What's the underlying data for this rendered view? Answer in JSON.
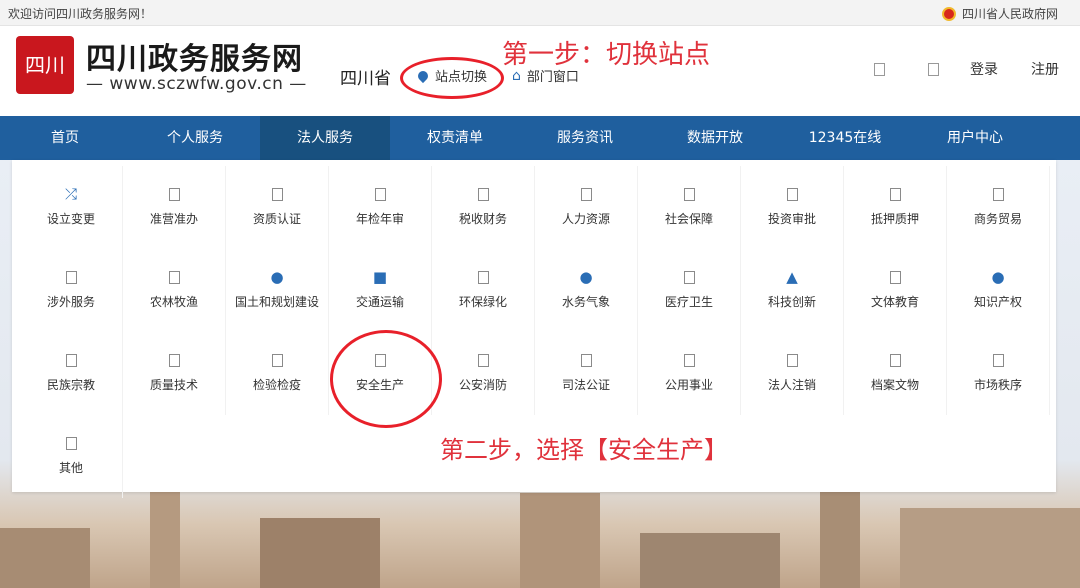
{
  "topbar": {
    "welcome": "欢迎访问四川政务服务网！",
    "gov_link": "四川省人民政府网"
  },
  "header": {
    "seal_text": "四川",
    "title": "四川政务服务网",
    "url": "— www.sczwfw.gov.cn —",
    "province": "四川省",
    "switch_label": "站点切换",
    "dept_label": "部门窗口",
    "login": "登录",
    "register": "注册"
  },
  "annotations": {
    "step1": "第一步：切换站点",
    "step2": "第二步，选择【安全生产】",
    "circle_color": "#e8202a"
  },
  "nav": [
    "首页",
    "个人服务",
    "法人服务",
    "权责清单",
    "服务资讯",
    "数据开放",
    "12345在线",
    "用户中心"
  ],
  "nav_active": "法人服务",
  "colors": {
    "nav_bg": "#1f5f9e",
    "accent": "#2a6db5",
    "annotation": "#e0323c"
  },
  "categories": [
    {
      "label": "设立变更",
      "icon": "shuffle-icon"
    },
    {
      "label": "准营准办",
      "icon": "box-icon"
    },
    {
      "label": "资质认证",
      "icon": "box-icon"
    },
    {
      "label": "年检年审",
      "icon": "box-icon"
    },
    {
      "label": "税收财务",
      "icon": "box-icon"
    },
    {
      "label": "人力资源",
      "icon": "box-icon"
    },
    {
      "label": "社会保障",
      "icon": "box-icon"
    },
    {
      "label": "投资审批",
      "icon": "box-icon"
    },
    {
      "label": "抵押质押",
      "icon": "box-icon"
    },
    {
      "label": "商务贸易",
      "icon": "box-icon"
    },
    {
      "label": "涉外服务",
      "icon": "box-icon"
    },
    {
      "label": "农林牧渔",
      "icon": "box-icon"
    },
    {
      "label": "国土和规划建设",
      "icon": "globe-icon"
    },
    {
      "label": "交通运输",
      "icon": "truck-icon"
    },
    {
      "label": "环保绿化",
      "icon": "box-icon"
    },
    {
      "label": "水务气象",
      "icon": "droplet-icon"
    },
    {
      "label": "医疗卫生",
      "icon": "box-icon"
    },
    {
      "label": "科技创新",
      "icon": "flask-icon"
    },
    {
      "label": "文体教育",
      "icon": "box-icon"
    },
    {
      "label": "知识产权",
      "icon": "lightbulb-icon"
    },
    {
      "label": "民族宗教",
      "icon": "box-icon"
    },
    {
      "label": "质量技术",
      "icon": "box-icon"
    },
    {
      "label": "检验检疫",
      "icon": "box-icon"
    },
    {
      "label": "安全生产",
      "icon": "box-icon"
    },
    {
      "label": "公安消防",
      "icon": "box-icon"
    },
    {
      "label": "司法公证",
      "icon": "box-icon"
    },
    {
      "label": "公用事业",
      "icon": "box-icon"
    },
    {
      "label": "法人注销",
      "icon": "box-icon"
    },
    {
      "label": "档案文物",
      "icon": "box-icon"
    },
    {
      "label": "市场秩序",
      "icon": "box-icon"
    },
    {
      "label": "其他",
      "icon": "box-icon"
    }
  ]
}
